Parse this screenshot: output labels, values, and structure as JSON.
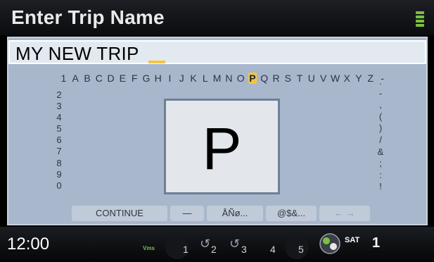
{
  "header": {
    "title": "Enter Trip Name",
    "signal_icon": "signal-bars-icon"
  },
  "entry": {
    "value": "MY NEW TRIP"
  },
  "keyboard": {
    "letters": [
      "1",
      "A",
      "B",
      "C",
      "D",
      "E",
      "F",
      "G",
      "H",
      "I",
      "J",
      "K",
      "L",
      "M",
      "N",
      "O",
      "P",
      "Q",
      "R",
      "S",
      "T",
      "U",
      "V",
      "W",
      "X",
      "Y",
      "Z",
      "-"
    ],
    "selected_letter": "P",
    "digits": [
      "2",
      "3",
      "4",
      "5",
      "6",
      "7",
      "8",
      "9",
      "0"
    ],
    "symbols": [
      ".",
      "-",
      ",",
      "(",
      ")",
      "/",
      "&",
      ";",
      ":",
      "!"
    ],
    "preview_letter": "P"
  },
  "actions": {
    "continue": "CONTINUE",
    "space": "—",
    "accents": "ÅÑø...",
    "specials": "@$&...",
    "disabled": "← →"
  },
  "status": {
    "time": "12:00",
    "mode": "Vms",
    "presets": [
      "1",
      "2",
      "3",
      "4",
      "5"
    ],
    "sat_label": "SAT",
    "sat_number": "1"
  },
  "colors": {
    "selection": "#f4c542",
    "panel": "#a9b7cc",
    "accent_green": "#7bc043"
  }
}
